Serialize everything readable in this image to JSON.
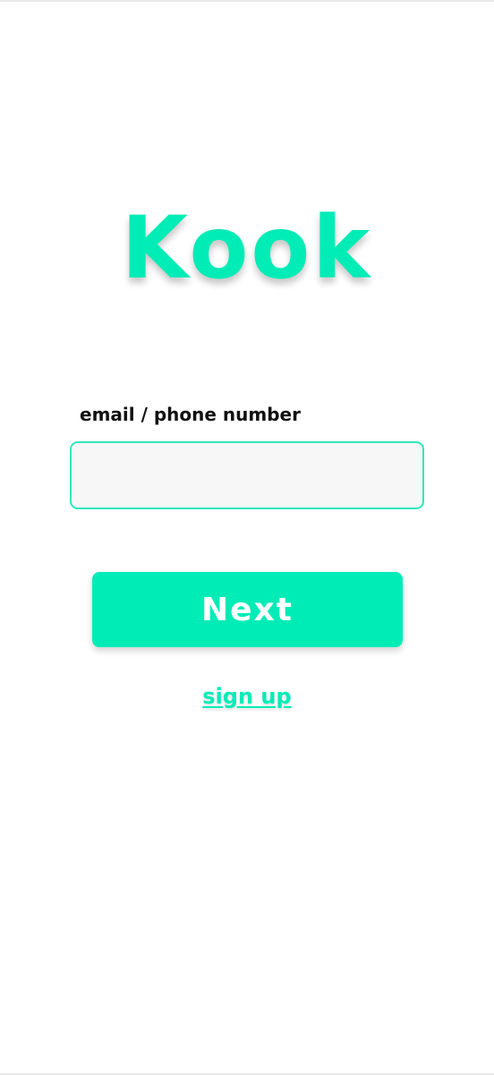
{
  "app": {
    "title": "Kook"
  },
  "login": {
    "field_label": "email / phone number",
    "input_value": "",
    "input_placeholder": "",
    "next_label": "Next",
    "signup_label": "sign up"
  },
  "colors": {
    "accent": "#00ecb7",
    "input_border": "#2ee8bd",
    "input_bg": "#f7f7f7",
    "label_text": "#111111",
    "background": "#ffffff"
  }
}
